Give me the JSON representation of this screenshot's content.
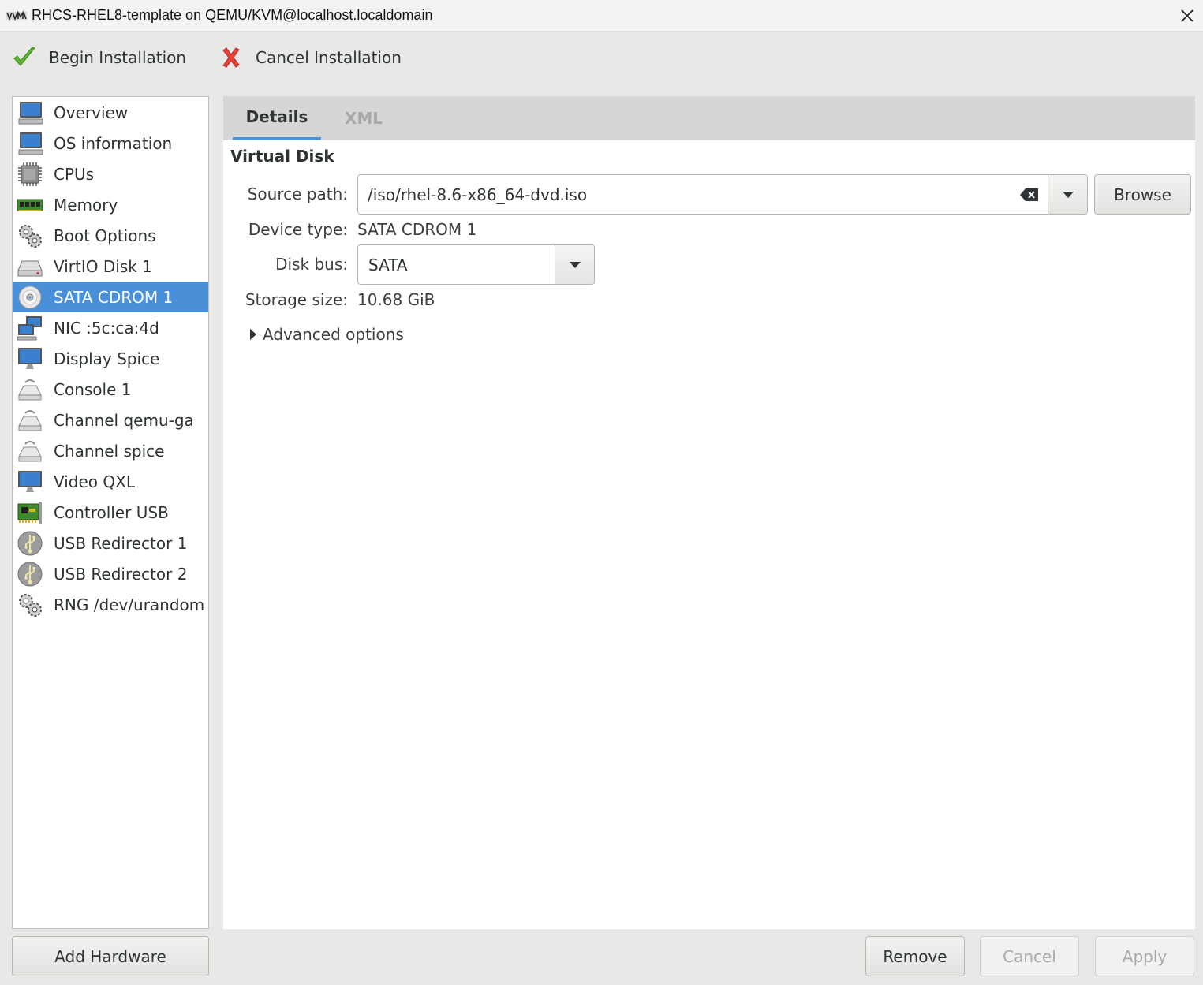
{
  "window": {
    "title": "RHCS-RHEL8-template on QEMU/KVM@localhost.localdomain",
    "logo_icon": "virt-manager-logo",
    "close_icon": "close-icon"
  },
  "toolbar": {
    "begin_label": "Begin Installation",
    "begin_icon": "checkmark-icon",
    "cancel_label": "Cancel Installation",
    "cancel_icon": "cross-icon"
  },
  "sidebar": {
    "items": [
      {
        "label": "Overview",
        "icon": "monitor-icon"
      },
      {
        "label": "OS information",
        "icon": "monitor-icon"
      },
      {
        "label": "CPUs",
        "icon": "cpu-chip-icon"
      },
      {
        "label": "Memory",
        "icon": "memory-module-icon"
      },
      {
        "label": "Boot Options",
        "icon": "gears-icon"
      },
      {
        "label": "VirtIO Disk 1",
        "icon": "hard-disk-icon"
      },
      {
        "label": "SATA CDROM 1",
        "icon": "cdrom-disc-icon",
        "selected": true
      },
      {
        "label": "NIC :5c:ca:4d",
        "icon": "network-icon"
      },
      {
        "label": "Display Spice",
        "icon": "monitor-icon"
      },
      {
        "label": "Console 1",
        "icon": "serial-device-icon"
      },
      {
        "label": "Channel qemu-ga",
        "icon": "serial-device-icon"
      },
      {
        "label": "Channel spice",
        "icon": "serial-device-icon"
      },
      {
        "label": "Video QXL",
        "icon": "monitor-icon"
      },
      {
        "label": "Controller USB",
        "icon": "pci-card-icon"
      },
      {
        "label": "USB Redirector 1",
        "icon": "usb-icon"
      },
      {
        "label": "USB Redirector 2",
        "icon": "usb-icon"
      },
      {
        "label": "RNG /dev/urandom",
        "icon": "gears-icon"
      }
    ],
    "add_hardware_label": "Add Hardware"
  },
  "tabs": [
    {
      "label": "Details",
      "active": true
    },
    {
      "label": "XML",
      "active": false
    }
  ],
  "details": {
    "section_title": "Virtual Disk",
    "source_path_label": "Source path:",
    "source_path_value": "/iso/rhel-8.6-x86_64-dvd.iso",
    "browse_label": "Browse",
    "device_type_label": "Device type:",
    "device_type_value": "SATA CDROM 1",
    "disk_bus_label": "Disk bus:",
    "disk_bus_value": "SATA",
    "storage_size_label": "Storage size:",
    "storage_size_value": "10.68 GiB",
    "advanced_label": "Advanced options"
  },
  "buttons": {
    "remove": "Remove",
    "cancel": "Cancel",
    "apply": "Apply"
  },
  "colors": {
    "selection": "#4a90d9",
    "window_bg": "#e8e8e7"
  }
}
